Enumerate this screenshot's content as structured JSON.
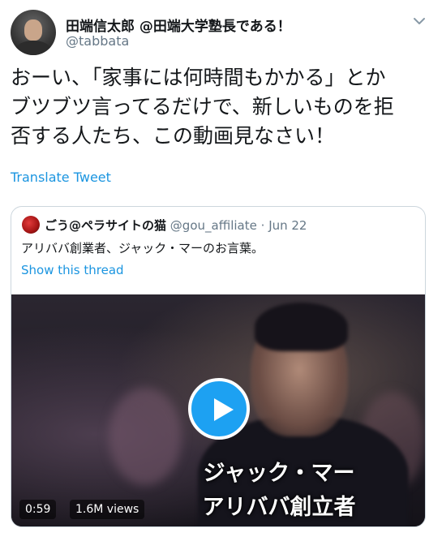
{
  "author": {
    "display_name": "田端信太郎 @田端大学塾長である！",
    "handle": "@tabbata"
  },
  "tweet": {
    "text_lines": [
      "おーい、「家事には何時間もかかる」とか",
      "ブツブツ言ってるだけで、新しいものを拒",
      "否する人たち、この動画見なさい！"
    ],
    "translate_label": "Translate Tweet"
  },
  "quoted_tweet": {
    "display_name": "ごう@ペラサイトの猫",
    "handle": "@gou_affiliate",
    "separator": "·",
    "date": "Jun 22",
    "text": "アリババ創業者、ジャック・マーのお言葉。",
    "show_thread_label": "Show this thread",
    "video": {
      "caption_line1": "ジャック・マー",
      "caption_line2": "アリババ創立者",
      "duration": "0:59",
      "views": "1.6M views"
    }
  },
  "colors": {
    "link": "#1b95e0",
    "play_button": "#1da1f2",
    "secondary_text": "#657786",
    "border": "#ccd6dd"
  },
  "icons": [
    "chevron-down-icon",
    "play-icon"
  ]
}
